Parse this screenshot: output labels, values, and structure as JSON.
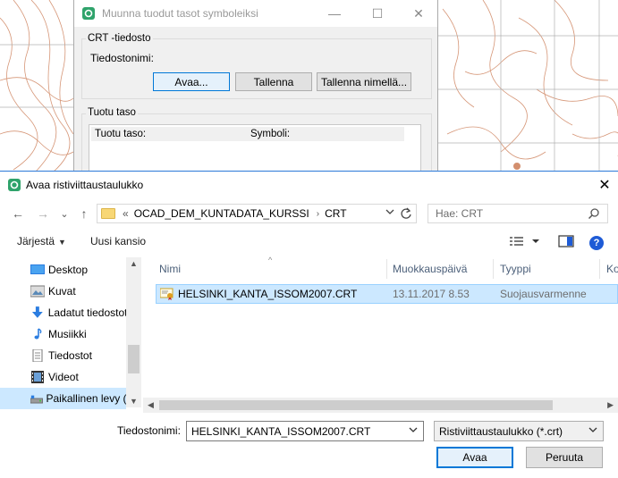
{
  "background_dialog": {
    "title": "Muunna tuodut tasot symboleiksi",
    "crt_group_label": "CRT -tiedosto",
    "filename_label": "Tiedostonimi:",
    "buttons": {
      "open": "Avaa...",
      "save": "Tallenna",
      "save_as": "Tallenna nimellä..."
    },
    "layer_group_label": "Tuotu taso",
    "columns": {
      "layer": "Tuotu taso:",
      "symbol": "Symboli:"
    },
    "window_controls": {
      "minimize": "—",
      "maximize": "☐",
      "close": "✕"
    }
  },
  "file_dialog": {
    "title": "Avaa ristiviittaustaulukko",
    "close_glyph": "✕",
    "nav": {
      "back": "←",
      "forward": "→",
      "recent": "⌄",
      "up": "↑"
    },
    "address": {
      "overflow": "«",
      "crumbs": [
        "OCAD_DEM_KUNTADATA_KURSSI",
        "CRT"
      ],
      "separator": "›"
    },
    "search": {
      "placeholder": "Hae: CRT"
    },
    "toolbar": {
      "organize": "Järjestä",
      "new_folder": "Uusi kansio"
    },
    "nav_pane": [
      {
        "label": "Desktop",
        "icon": "desktop-icon"
      },
      {
        "label": "Kuvat",
        "icon": "pictures-icon"
      },
      {
        "label": "Ladatut tiedostot",
        "icon": "downloads-icon"
      },
      {
        "label": "Musiikki",
        "icon": "music-icon"
      },
      {
        "label": "Tiedostot",
        "icon": "documents-icon"
      },
      {
        "label": "Videot",
        "icon": "videos-icon"
      },
      {
        "label": "Paikallinen levy (C:)",
        "icon": "drive-icon",
        "selected": true
      }
    ],
    "columns": {
      "name": "Nimi",
      "modified": "Muokkauspäivä",
      "type": "Tyyppi",
      "size": "Ko"
    },
    "files": [
      {
        "name": "HELSINKI_KANTA_ISSOM2007.CRT",
        "modified": "13.11.2017 8.53",
        "type": "Suojausvarmenne",
        "icon": "certificate-icon",
        "selected": true
      }
    ],
    "filename": {
      "label": "Tiedostonimi:",
      "value": "HELSINKI_KANTA_ISSOM2007.CRT"
    },
    "filetype": {
      "value": "Ristiviittaustaulukko (*.crt)"
    },
    "buttons": {
      "open": "Avaa",
      "cancel": "Peruuta"
    }
  },
  "colors": {
    "accent": "#0078d7",
    "selection": "#cce8ff",
    "map_contour": "#c8734a",
    "map_grid": "#b0b0b0"
  }
}
